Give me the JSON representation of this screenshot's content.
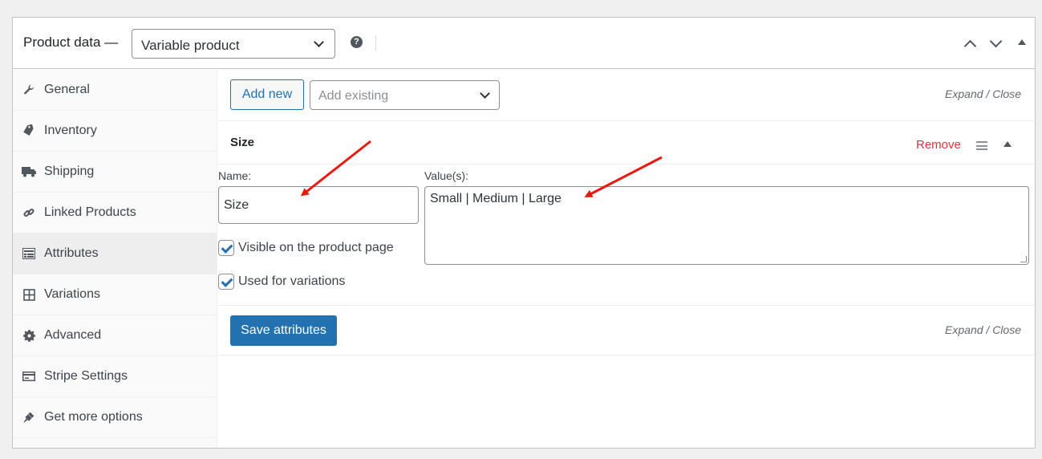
{
  "header": {
    "title": "Product data —",
    "product_type": "Variable product",
    "help_icon": "?"
  },
  "sidebar": {
    "items": [
      {
        "label": "General",
        "icon": "wrench-icon"
      },
      {
        "label": "Inventory",
        "icon": "tag-icon"
      },
      {
        "label": "Shipping",
        "icon": "truck-icon"
      },
      {
        "label": "Linked Products",
        "icon": "link-icon"
      },
      {
        "label": "Attributes",
        "icon": "list-icon",
        "active": true
      },
      {
        "label": "Variations",
        "icon": "grid-icon"
      },
      {
        "label": "Advanced",
        "icon": "gear-icon"
      },
      {
        "label": "Stripe Settings",
        "icon": "card-icon"
      },
      {
        "label": "Get more options",
        "icon": "plugin-icon"
      }
    ]
  },
  "toolbar": {
    "add_new": "Add new",
    "add_existing_placeholder": "Add existing",
    "expand_close": "Expand / Close"
  },
  "attribute": {
    "title": "Size",
    "remove": "Remove",
    "name_label": "Name:",
    "name_value": "Size",
    "values_label": "Value(s):",
    "values_value": "Small | Medium | Large",
    "visible_label": "Visible on the product page",
    "variations_label": "Used for variations"
  },
  "footer": {
    "save": "Save attributes",
    "expand_close": "Expand / Close"
  },
  "colors": {
    "accent": "#2271b1",
    "danger": "#d63638",
    "annotation_arrow": "#e8190f"
  }
}
